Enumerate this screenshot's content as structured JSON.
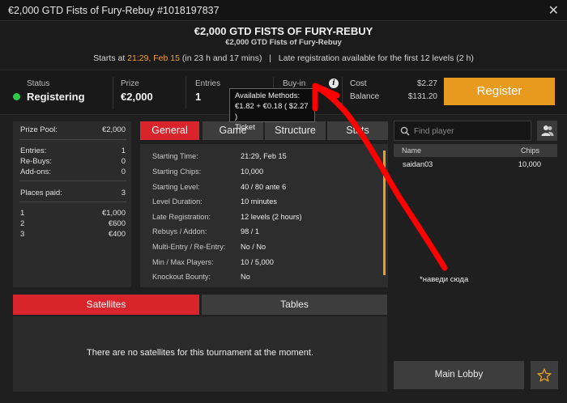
{
  "window": {
    "title": "€2,000 GTD Fists of Fury-Rebuy #1018197837",
    "close_glyph": "✕"
  },
  "header": {
    "title": "€2,000 GTD FISTS OF FURY-REBUY",
    "subtitle": "€2,000 GTD Fists of Fury-Rebuy",
    "starts_prefix": "Starts at ",
    "starts_time": "21:29, Feb 15",
    "starts_suffix": " (in 23 h and 17 mins)",
    "divider": "|",
    "late_reg_prefix": "Late registration available for the first 12 levels ",
    "late_reg_hours": "(2 h)"
  },
  "info": {
    "status_label": "Status",
    "status_value": "Registering",
    "prize_label": "Prize",
    "prize_value": "€2,000",
    "entries_label": "Entries",
    "entries_value": "1",
    "buyin_label": "Buy-in",
    "info_icon": "i",
    "cost_label": "Cost",
    "cost_value": "$2.27",
    "balance_label": "Balance",
    "balance_value": "$131.20",
    "register_label": "Register"
  },
  "tooltip": {
    "line1": "Available Methods:",
    "line2": "€1.82 + €0.18 ( $2.27 )",
    "line3": "Ticket"
  },
  "prize_panel": {
    "pool_label": "Prize Pool:",
    "pool_value": "€2,000",
    "entries_label": "Entries:",
    "entries_value": "1",
    "rebuys_label": "Re-Buys:",
    "rebuys_value": "0",
    "addons_label": "Add-ons:",
    "addons_value": "0",
    "places_label": "Places paid:",
    "places_value": "3",
    "payouts": [
      {
        "place": "1",
        "amount": "€1,000"
      },
      {
        "place": "2",
        "amount": "€600"
      },
      {
        "place": "3",
        "amount": "€400"
      }
    ]
  },
  "tabs": [
    "General",
    "Game",
    "Structure",
    "Stats"
  ],
  "general": [
    {
      "key": "Starting Time:",
      "value": "21:29, Feb 15"
    },
    {
      "key": "Starting Chips:",
      "value": "10,000"
    },
    {
      "key": "Starting Level:",
      "value": "40 / 80 ante 6"
    },
    {
      "key": "Level Duration:",
      "value": "10 minutes"
    },
    {
      "key": "Late Registration:",
      "value": "12 levels (2 hours)"
    },
    {
      "key": "Rebuys / Addon:",
      "value": "98 / 1"
    },
    {
      "key": "Multi-Entry / Re-Entry:",
      "value": "No / No"
    },
    {
      "key": "Min / Max Players:",
      "value": "10 / 5,000"
    },
    {
      "key": "Knockout Bounty:",
      "value": "No"
    }
  ],
  "players": {
    "search_placeholder": "Find player",
    "col_name": "Name",
    "col_chips": "Chips",
    "rows": [
      {
        "name": "saidan03",
        "chips": "10,000"
      }
    ]
  },
  "annotation": "*наведи сюда",
  "satellites": {
    "tab_satellites": "Satellites",
    "tab_tables": "Tables",
    "message": "There are no satellites for this tournament at the moment."
  },
  "footer": {
    "main_lobby": "Main Lobby"
  },
  "colors": {
    "accent_red": "#d8242a",
    "accent_orange": "#e89a1e",
    "status_green": "#2ec84a",
    "annotation_red": "#ff0000"
  },
  "icons": {
    "search": "search-icon",
    "find_player": "users-icon",
    "favorite": "star-icon",
    "info": "info-icon",
    "close": "close-icon"
  }
}
